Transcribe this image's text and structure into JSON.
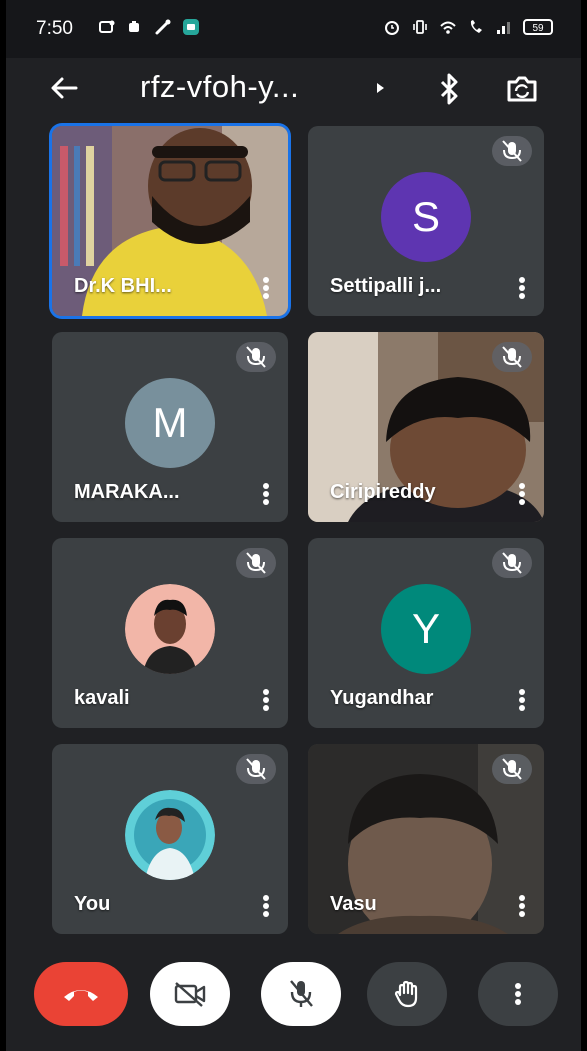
{
  "status_bar": {
    "time": "7:50",
    "battery": "59",
    "left_icons": [
      "notification-dot-icon",
      "app-icon",
      "wrench-icon",
      "chat-app-icon"
    ],
    "right_icons": [
      "alarm-icon",
      "vibrate-icon",
      "wifi-icon",
      "call-icon",
      "signal-icon",
      "battery-icon"
    ]
  },
  "header": {
    "meeting_code": "rfz-vfoh-y..."
  },
  "participants": [
    {
      "name": "Dr.K BHI...",
      "type": "video",
      "active": true
    },
    {
      "name": "Settipalli j...",
      "type": "initial",
      "initial": "S",
      "avatar_color": "#5e35b1",
      "muted": true
    },
    {
      "name": "MARAKA...",
      "type": "initial",
      "initial": "M",
      "avatar_color": "#78909c",
      "muted": true
    },
    {
      "name": "Ciripireddy",
      "type": "video",
      "muted": true
    },
    {
      "name": "kavali",
      "type": "photo",
      "muted": true
    },
    {
      "name": "Yugandhar",
      "type": "initial",
      "initial": "Y",
      "avatar_color": "#00897b",
      "muted": true
    },
    {
      "name": "You",
      "type": "photo",
      "muted": true
    },
    {
      "name": "Vasu",
      "type": "video",
      "muted": true
    }
  ],
  "controls": [
    "end-call",
    "camera-off",
    "mic-off",
    "raise-hand",
    "more-options"
  ],
  "colors": {
    "background": "#202124",
    "tile": "#3c4043",
    "end_call": "#ea4335",
    "active_border": "#1a73e8"
  }
}
